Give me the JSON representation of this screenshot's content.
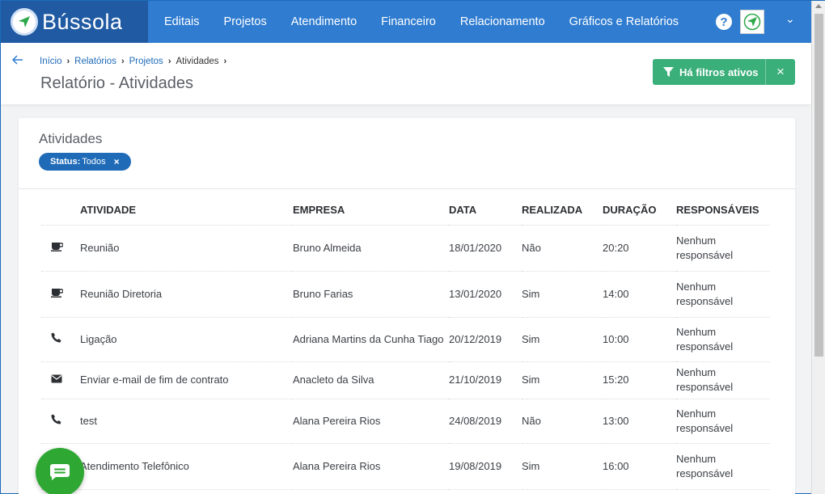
{
  "brand": {
    "name": "Bússola"
  },
  "nav": {
    "items": [
      "Editais",
      "Projetos",
      "Atendimento",
      "Financeiro",
      "Relacionamento",
      "Gráficos e Relatórios"
    ]
  },
  "topbar": {
    "help": "?"
  },
  "breadcrumb": [
    {
      "label": "Início"
    },
    {
      "label": "Relatórios"
    },
    {
      "label": "Projetos"
    },
    {
      "label": "Atividades"
    }
  ],
  "page": {
    "title": "Relatório - Atividades"
  },
  "filters": {
    "button_label": "Há filtros ativos",
    "close": "×"
  },
  "card": {
    "title": "Atividades",
    "chip": {
      "key": "Status:",
      "value": "Todos",
      "close": "×"
    }
  },
  "table": {
    "headers": [
      "ATIVIDADE",
      "EMPRESA",
      "DATA",
      "REALIZADA",
      "DURAÇÃO",
      "RESPONSÁVEIS"
    ],
    "rows": [
      {
        "icon": "coffee-icon",
        "atividade": "Reunião",
        "empresa": "Bruno Almeida",
        "data": "18/01/2020",
        "realizada": "Não",
        "duracao": "20:20",
        "resp1": "Nenhum",
        "resp2": "responsável"
      },
      {
        "icon": "coffee-icon",
        "atividade": "Reunião Diretoria",
        "empresa": "Bruno Farias",
        "data": "13/01/2020",
        "realizada": "Sim",
        "duracao": "14:00",
        "resp1": "Nenhum",
        "resp2": "responsável"
      },
      {
        "icon": "phone-icon",
        "atividade": "Ligação",
        "empresa": "Adriana Martins da Cunha Tiago",
        "data": "20/12/2019",
        "realizada": "Sim",
        "duracao": "10:00",
        "resp1": "Nenhum",
        "resp2": "responsável"
      },
      {
        "icon": "envelope-icon",
        "atividade": "Enviar e-mail de fim de contrato",
        "empresa": "Anacleto da Silva",
        "data": "21/10/2019",
        "realizada": "Sim",
        "duracao": "15:20",
        "resp1": "Nenhum",
        "resp2": "responsável"
      },
      {
        "icon": "phone-icon",
        "atividade": "test",
        "empresa": "Alana Pereira Rios",
        "data": "24/08/2019",
        "realizada": "Não",
        "duracao": "13:00",
        "resp1": "Nenhum",
        "resp2": "responsável"
      },
      {
        "icon": "phone-icon",
        "atividade": "Atendimento Telefônico",
        "empresa": "Alana Pereira Rios",
        "data": "19/08/2019",
        "realizada": "Sim",
        "duracao": "16:00",
        "resp1": "Nenhum",
        "resp2": "responsável"
      }
    ]
  },
  "colors": {
    "nav": "#2f7cd0",
    "brand_block": "#1f5aa3",
    "filter_button": "#3aaf7a",
    "chip": "#1f6bb8",
    "chat": "#2ea832"
  }
}
